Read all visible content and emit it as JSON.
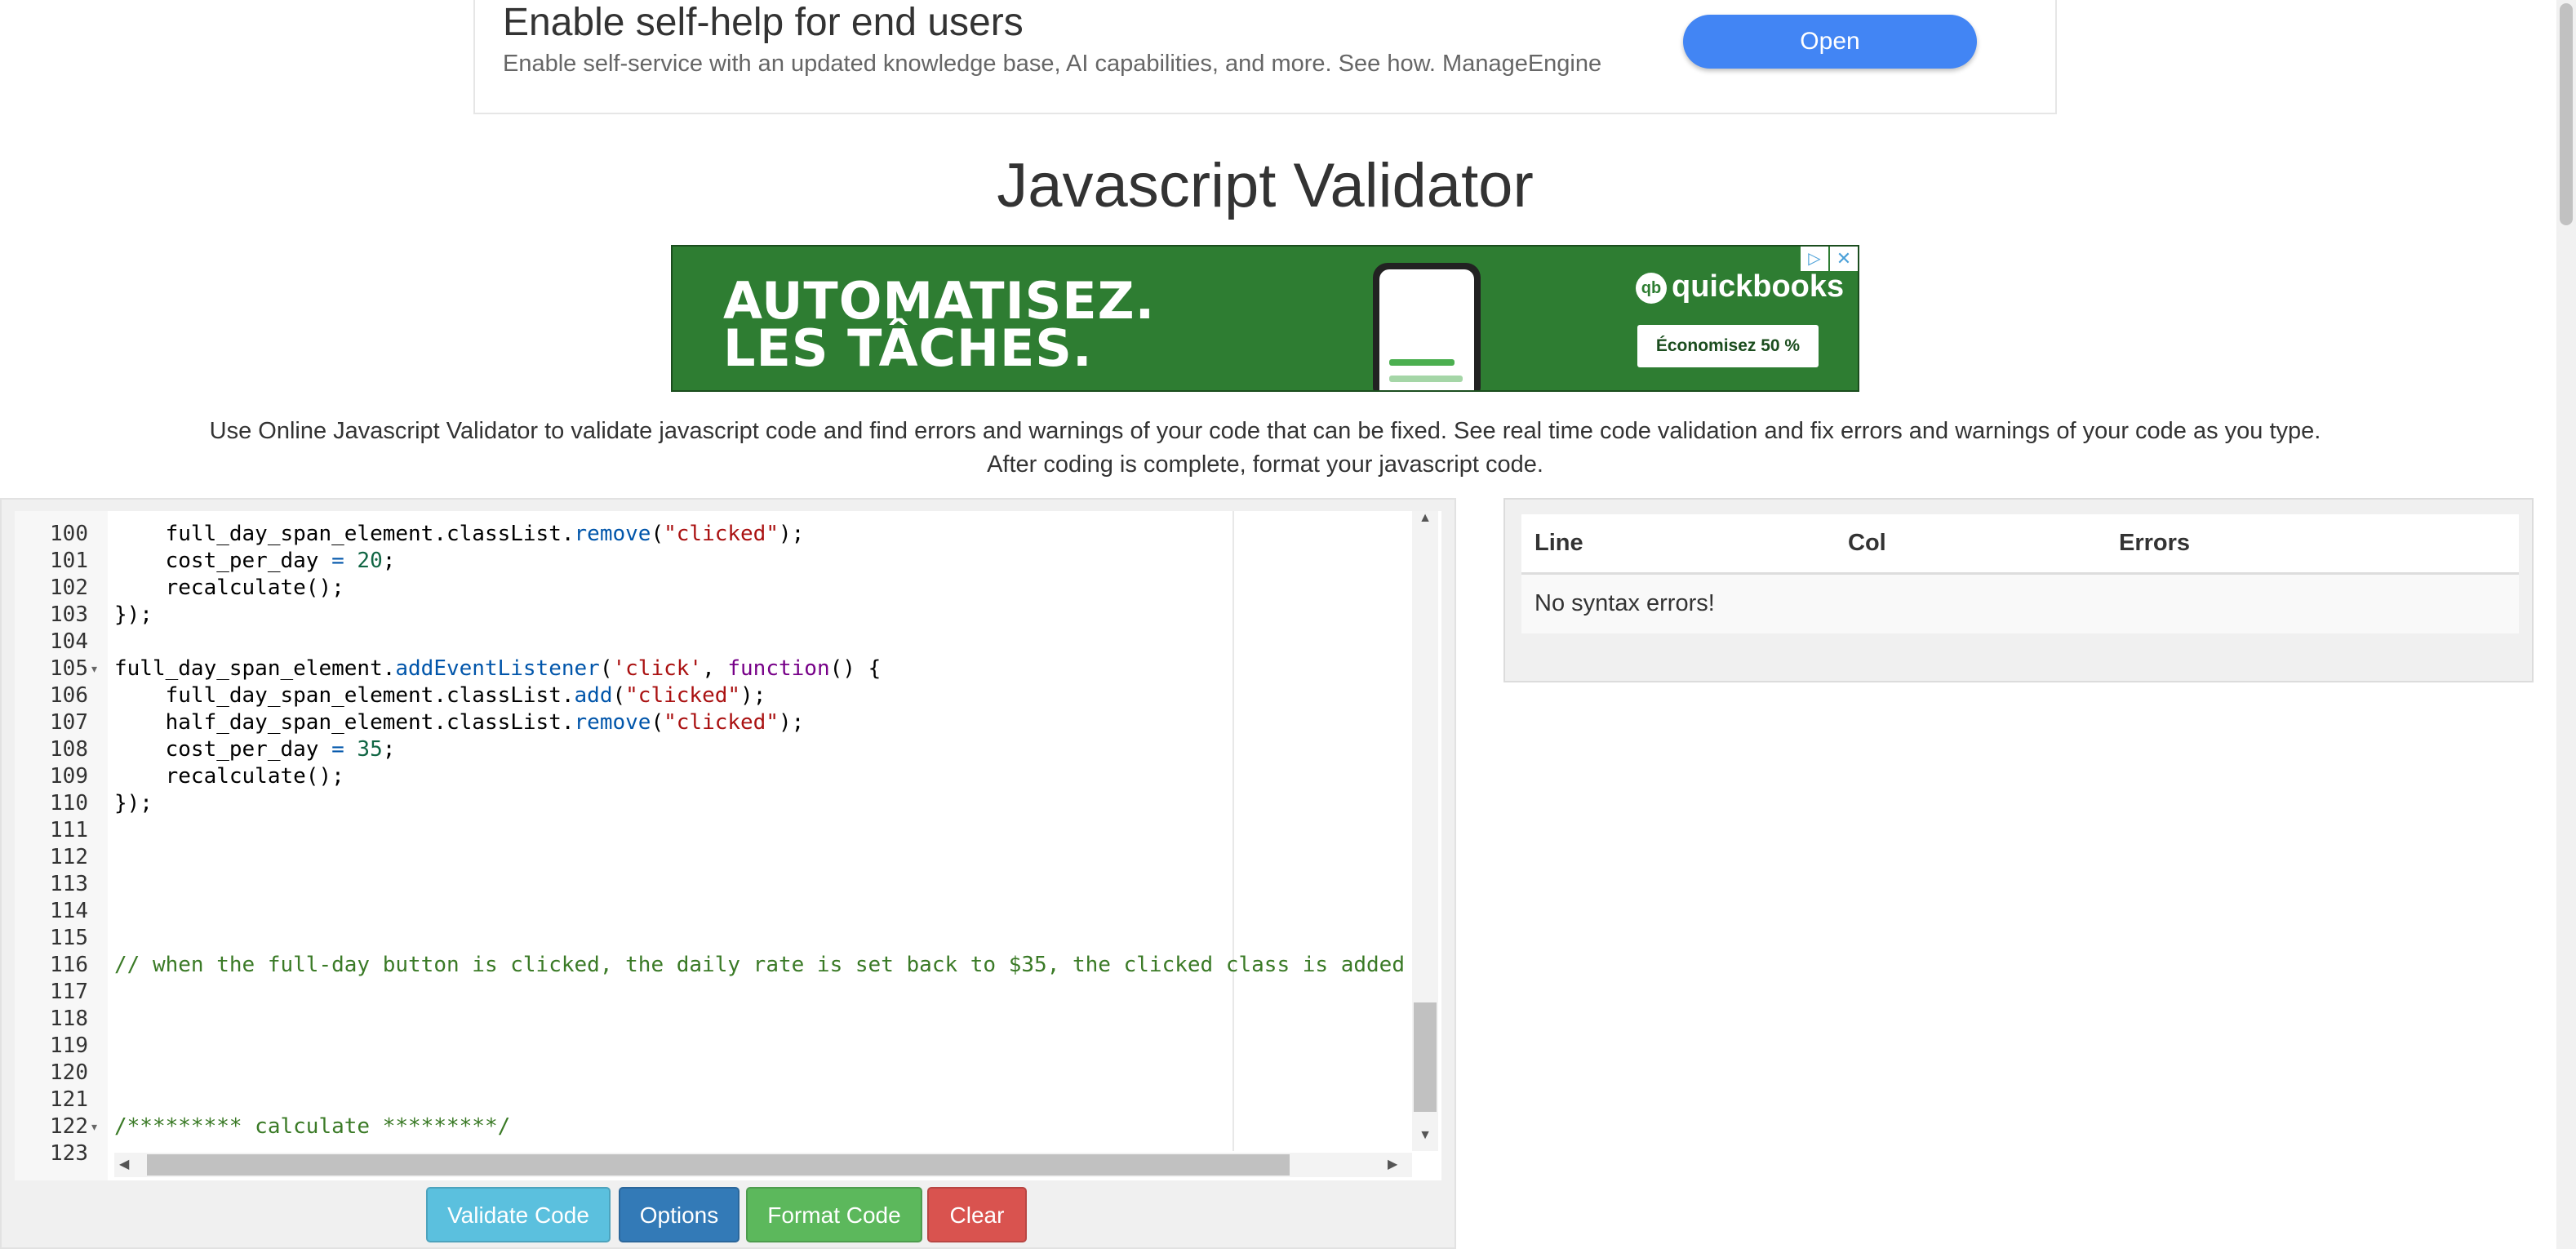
{
  "top_ad": {
    "title": "Enable self-help for end users",
    "subtitle": "Enable self-service with an updated knowledge base, AI capabilities, and more. See how. ManageEngine",
    "button_label": "Open"
  },
  "page_title": "Javascript Validator",
  "banner_ad": {
    "line1": "AUTOMATISEZ.",
    "line2": "LES TÂCHES.",
    "brand": "quickbooks",
    "cta": "Économisez 50 %",
    "colors": {
      "background": "#2e7d32"
    }
  },
  "description": "Use Online Javascript Validator to validate javascript code and find errors and warnings of your code that can be fixed. See real time code validation and fix errors and warnings of your code as you type. After coding is complete, format your javascript code.",
  "editor": {
    "lines": [
      {
        "n": "100",
        "fold": false,
        "tokens": [
          [
            "    full_day_span_element.classList.",
            "t-prop"
          ],
          [
            "remove",
            "t-fn"
          ],
          [
            "(",
            "t-prop"
          ],
          [
            "\"clicked\"",
            "t-str"
          ],
          [
            ");",
            "t-prop"
          ]
        ]
      },
      {
        "n": "101",
        "fold": false,
        "tokens": [
          [
            "    cost_per_day ",
            "t-prop"
          ],
          [
            "=",
            "t-fn"
          ],
          [
            " ",
            "t-prop"
          ],
          [
            "20",
            "t-num"
          ],
          [
            ";",
            "t-prop"
          ]
        ]
      },
      {
        "n": "102",
        "fold": false,
        "tokens": [
          [
            "    recalculate();",
            "t-prop"
          ]
        ]
      },
      {
        "n": "103",
        "fold": false,
        "tokens": [
          [
            "});",
            "t-prop"
          ]
        ]
      },
      {
        "n": "104",
        "fold": false,
        "tokens": []
      },
      {
        "n": "105",
        "fold": true,
        "tokens": [
          [
            "full_day_span_element.",
            "t-prop"
          ],
          [
            "addEventListener",
            "t-fn"
          ],
          [
            "(",
            "t-prop"
          ],
          [
            "'click'",
            "t-str"
          ],
          [
            ", ",
            "t-prop"
          ],
          [
            "function",
            "t-kw"
          ],
          [
            "() {",
            "t-prop"
          ]
        ]
      },
      {
        "n": "106",
        "fold": false,
        "tokens": [
          [
            "    full_day_span_element.classList.",
            "t-prop"
          ],
          [
            "add",
            "t-fn"
          ],
          [
            "(",
            "t-prop"
          ],
          [
            "\"clicked\"",
            "t-str"
          ],
          [
            ");",
            "t-prop"
          ]
        ]
      },
      {
        "n": "107",
        "fold": false,
        "tokens": [
          [
            "    half_day_span_element.classList.",
            "t-prop"
          ],
          [
            "remove",
            "t-fn"
          ],
          [
            "(",
            "t-prop"
          ],
          [
            "\"clicked\"",
            "t-str"
          ],
          [
            ");",
            "t-prop"
          ]
        ]
      },
      {
        "n": "108",
        "fold": false,
        "tokens": [
          [
            "    cost_per_day ",
            "t-prop"
          ],
          [
            "=",
            "t-fn"
          ],
          [
            " ",
            "t-prop"
          ],
          [
            "35",
            "t-num"
          ],
          [
            ";",
            "t-prop"
          ]
        ]
      },
      {
        "n": "109",
        "fold": false,
        "tokens": [
          [
            "    recalculate();",
            "t-prop"
          ]
        ]
      },
      {
        "n": "110",
        "fold": false,
        "tokens": [
          [
            "});",
            "t-prop"
          ]
        ]
      },
      {
        "n": "111",
        "fold": false,
        "tokens": []
      },
      {
        "n": "112",
        "fold": false,
        "tokens": []
      },
      {
        "n": "113",
        "fold": false,
        "tokens": []
      },
      {
        "n": "114",
        "fold": false,
        "tokens": []
      },
      {
        "n": "115",
        "fold": false,
        "tokens": []
      },
      {
        "n": "116",
        "fold": false,
        "tokens": [
          [
            "// when the full-day button is clicked, the daily rate is set back to $35, the clicked class is added to",
            "t-cm"
          ]
        ]
      },
      {
        "n": "117",
        "fold": false,
        "tokens": []
      },
      {
        "n": "118",
        "fold": false,
        "tokens": []
      },
      {
        "n": "119",
        "fold": false,
        "tokens": []
      },
      {
        "n": "120",
        "fold": false,
        "tokens": []
      },
      {
        "n": "121",
        "fold": false,
        "tokens": []
      },
      {
        "n": "122",
        "fold": true,
        "tokens": [
          [
            "/********* calculate *********/",
            "t-cm"
          ]
        ]
      },
      {
        "n": "123",
        "fold": false,
        "tokens": []
      }
    ]
  },
  "buttons": {
    "validate": "Validate Code",
    "options": "Options",
    "format": "Format Code",
    "clear": "Clear"
  },
  "results": {
    "headers": [
      "Line",
      "Col",
      "Errors"
    ],
    "message": "No syntax errors!"
  }
}
